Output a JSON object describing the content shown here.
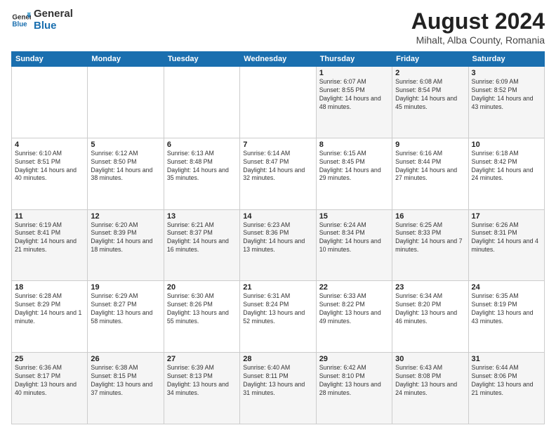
{
  "logo": {
    "line1": "General",
    "line2": "Blue"
  },
  "title": "August 2024",
  "subtitle": "Mihalt, Alba County, Romania",
  "days_header": [
    "Sunday",
    "Monday",
    "Tuesday",
    "Wednesday",
    "Thursday",
    "Friday",
    "Saturday"
  ],
  "weeks": [
    [
      {
        "num": "",
        "info": ""
      },
      {
        "num": "",
        "info": ""
      },
      {
        "num": "",
        "info": ""
      },
      {
        "num": "",
        "info": ""
      },
      {
        "num": "1",
        "info": "Sunrise: 6:07 AM\nSunset: 8:55 PM\nDaylight: 14 hours and 48 minutes."
      },
      {
        "num": "2",
        "info": "Sunrise: 6:08 AM\nSunset: 8:54 PM\nDaylight: 14 hours and 45 minutes."
      },
      {
        "num": "3",
        "info": "Sunrise: 6:09 AM\nSunset: 8:52 PM\nDaylight: 14 hours and 43 minutes."
      }
    ],
    [
      {
        "num": "4",
        "info": "Sunrise: 6:10 AM\nSunset: 8:51 PM\nDaylight: 14 hours and 40 minutes."
      },
      {
        "num": "5",
        "info": "Sunrise: 6:12 AM\nSunset: 8:50 PM\nDaylight: 14 hours and 38 minutes."
      },
      {
        "num": "6",
        "info": "Sunrise: 6:13 AM\nSunset: 8:48 PM\nDaylight: 14 hours and 35 minutes."
      },
      {
        "num": "7",
        "info": "Sunrise: 6:14 AM\nSunset: 8:47 PM\nDaylight: 14 hours and 32 minutes."
      },
      {
        "num": "8",
        "info": "Sunrise: 6:15 AM\nSunset: 8:45 PM\nDaylight: 14 hours and 29 minutes."
      },
      {
        "num": "9",
        "info": "Sunrise: 6:16 AM\nSunset: 8:44 PM\nDaylight: 14 hours and 27 minutes."
      },
      {
        "num": "10",
        "info": "Sunrise: 6:18 AM\nSunset: 8:42 PM\nDaylight: 14 hours and 24 minutes."
      }
    ],
    [
      {
        "num": "11",
        "info": "Sunrise: 6:19 AM\nSunset: 8:41 PM\nDaylight: 14 hours and 21 minutes."
      },
      {
        "num": "12",
        "info": "Sunrise: 6:20 AM\nSunset: 8:39 PM\nDaylight: 14 hours and 18 minutes."
      },
      {
        "num": "13",
        "info": "Sunrise: 6:21 AM\nSunset: 8:37 PM\nDaylight: 14 hours and 16 minutes."
      },
      {
        "num": "14",
        "info": "Sunrise: 6:23 AM\nSunset: 8:36 PM\nDaylight: 14 hours and 13 minutes."
      },
      {
        "num": "15",
        "info": "Sunrise: 6:24 AM\nSunset: 8:34 PM\nDaylight: 14 hours and 10 minutes."
      },
      {
        "num": "16",
        "info": "Sunrise: 6:25 AM\nSunset: 8:33 PM\nDaylight: 14 hours and 7 minutes."
      },
      {
        "num": "17",
        "info": "Sunrise: 6:26 AM\nSunset: 8:31 PM\nDaylight: 14 hours and 4 minutes."
      }
    ],
    [
      {
        "num": "18",
        "info": "Sunrise: 6:28 AM\nSunset: 8:29 PM\nDaylight: 14 hours and 1 minute."
      },
      {
        "num": "19",
        "info": "Sunrise: 6:29 AM\nSunset: 8:27 PM\nDaylight: 13 hours and 58 minutes."
      },
      {
        "num": "20",
        "info": "Sunrise: 6:30 AM\nSunset: 8:26 PM\nDaylight: 13 hours and 55 minutes."
      },
      {
        "num": "21",
        "info": "Sunrise: 6:31 AM\nSunset: 8:24 PM\nDaylight: 13 hours and 52 minutes."
      },
      {
        "num": "22",
        "info": "Sunrise: 6:33 AM\nSunset: 8:22 PM\nDaylight: 13 hours and 49 minutes."
      },
      {
        "num": "23",
        "info": "Sunrise: 6:34 AM\nSunset: 8:20 PM\nDaylight: 13 hours and 46 minutes."
      },
      {
        "num": "24",
        "info": "Sunrise: 6:35 AM\nSunset: 8:19 PM\nDaylight: 13 hours and 43 minutes."
      }
    ],
    [
      {
        "num": "25",
        "info": "Sunrise: 6:36 AM\nSunset: 8:17 PM\nDaylight: 13 hours and 40 minutes."
      },
      {
        "num": "26",
        "info": "Sunrise: 6:38 AM\nSunset: 8:15 PM\nDaylight: 13 hours and 37 minutes."
      },
      {
        "num": "27",
        "info": "Sunrise: 6:39 AM\nSunset: 8:13 PM\nDaylight: 13 hours and 34 minutes."
      },
      {
        "num": "28",
        "info": "Sunrise: 6:40 AM\nSunset: 8:11 PM\nDaylight: 13 hours and 31 minutes."
      },
      {
        "num": "29",
        "info": "Sunrise: 6:42 AM\nSunset: 8:10 PM\nDaylight: 13 hours and 28 minutes."
      },
      {
        "num": "30",
        "info": "Sunrise: 6:43 AM\nSunset: 8:08 PM\nDaylight: 13 hours and 24 minutes."
      },
      {
        "num": "31",
        "info": "Sunrise: 6:44 AM\nSunset: 8:06 PM\nDaylight: 13 hours and 21 minutes."
      }
    ]
  ]
}
